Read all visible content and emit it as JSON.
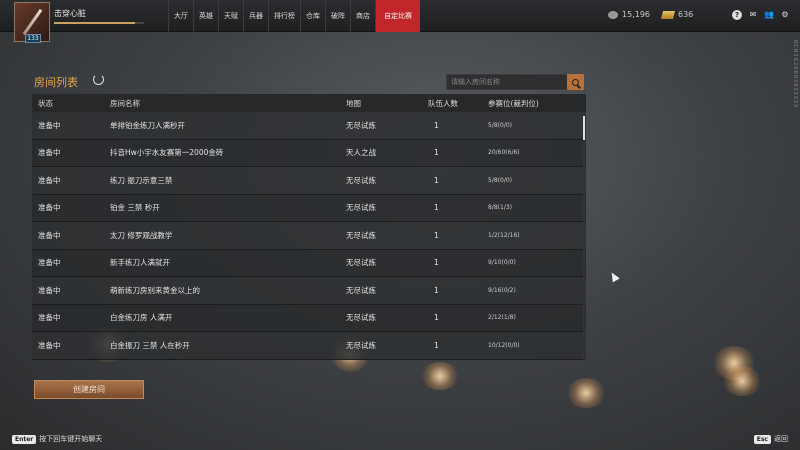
{
  "player": {
    "name": "击穿心脏",
    "level": "133",
    "exp_fraction": 0.9
  },
  "nav": {
    "items": [
      "大厅",
      "英雄",
      "天赋",
      "兵器",
      "排行榜",
      "仓库",
      "破阵",
      "商店",
      "自定比赛"
    ]
  },
  "currency": {
    "coins": "15,196",
    "gold": "636"
  },
  "icons": [
    "help-icon",
    "mail-icon",
    "friends-icon",
    "settings-icon"
  ],
  "side_id": "RCN1R20R02022025",
  "room_list": {
    "title": "房间列表",
    "search_placeholder": "请输入房间名称",
    "columns": [
      "状态",
      "房间名称",
      "地图",
      "队伍人数",
      "参赛位(裁判位)"
    ],
    "rows": [
      {
        "status": "准备中",
        "name": "单排铂金练刀人满秒开",
        "map": "无尽试炼",
        "team_size": "1",
        "seats": "5/8(0/0)"
      },
      {
        "status": "准备中",
        "name": "抖音Hw小宇水友赛第一2000金砖",
        "map": "天人之战",
        "team_size": "1",
        "seats": "20/60(6/6)"
      },
      {
        "status": "准备中",
        "name": "练刀 振刀示意三禁",
        "map": "无尽试炼",
        "team_size": "1",
        "seats": "5/8(0/0)"
      },
      {
        "status": "准备中",
        "name": "铂金 三禁 秒开",
        "map": "无尽试炼",
        "team_size": "1",
        "seats": "8/8(1/3)"
      },
      {
        "status": "准备中",
        "name": "太刀 修罗观战教学",
        "map": "无尽试炼",
        "team_size": "1",
        "seats": "1/2(12/16)"
      },
      {
        "status": "准备中",
        "name": "新手练刀人满就开",
        "map": "无尽试炼",
        "team_size": "1",
        "seats": "9/10(0/0)"
      },
      {
        "status": "准备中",
        "name": "萌新练刀房别来黄金以上的",
        "map": "无尽试炼",
        "team_size": "1",
        "seats": "9/16(0/2)"
      },
      {
        "status": "准备中",
        "name": "白金练刀房 人满开",
        "map": "无尽试炼",
        "team_size": "1",
        "seats": "2/12(1/8)"
      },
      {
        "status": "准备中",
        "name": "白金振刀 三禁 人在秒开",
        "map": "无尽试炼",
        "team_size": "1",
        "seats": "10/12(0/0)"
      }
    ],
    "create_button": "创建房间"
  },
  "hints": {
    "enter_key": "Enter",
    "enter_text": "按下回车键开始聊天",
    "esc_key": "Esc",
    "esc_text": "返回"
  },
  "colors": {
    "accent": "#e8a648",
    "active_tab": "#c0262a",
    "button": "#a8734a"
  }
}
